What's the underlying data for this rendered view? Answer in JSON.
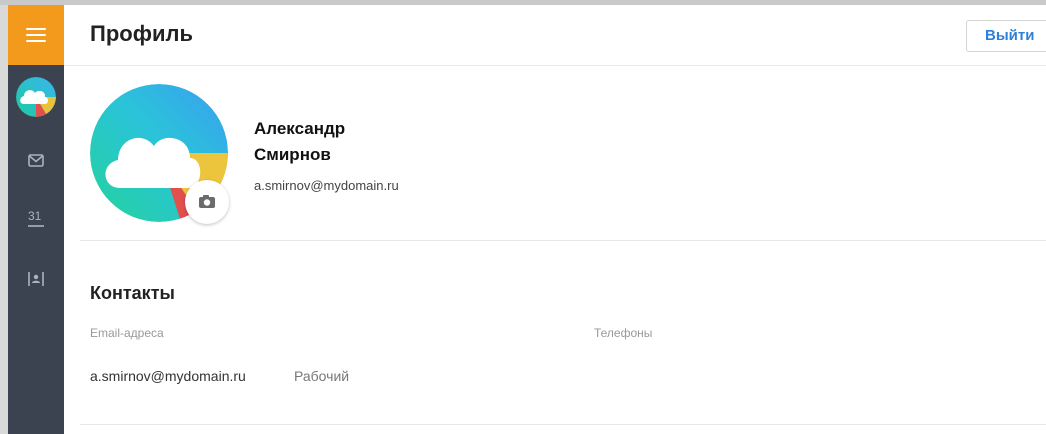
{
  "header": {
    "title": "Профиль",
    "logout_label": "Выйти"
  },
  "sidebar": {
    "items": [
      {
        "icon": "menu-icon"
      },
      {
        "icon": "avatar"
      },
      {
        "icon": "mail-icon"
      },
      {
        "icon": "calendar-icon",
        "label": "31"
      },
      {
        "icon": "contacts-icon"
      }
    ]
  },
  "profile": {
    "first_name": "Александр",
    "last_name": "Смирнов",
    "email": "a.smirnov@mydomain.ru"
  },
  "contacts": {
    "title": "Контакты",
    "email_label": "Email-адреса",
    "phone_label": "Телефоны",
    "emails": [
      {
        "address": "a.smirnov@mydomain.ru",
        "type": "Рабочий"
      }
    ]
  },
  "colors": {
    "accent": "#f39a1c",
    "sidebar": "#3b4350",
    "link": "#2f80d8"
  }
}
